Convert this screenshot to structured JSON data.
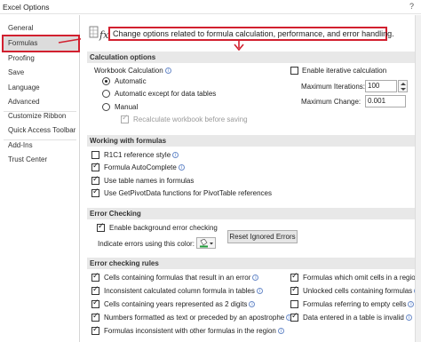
{
  "window": {
    "title": "Excel Options",
    "help": "?"
  },
  "sidebar": {
    "items": [
      {
        "label": "General"
      },
      {
        "label": "Formulas"
      },
      {
        "label": "Proofing"
      },
      {
        "label": "Save"
      },
      {
        "label": "Language"
      },
      {
        "label": "Advanced"
      },
      {
        "label": "Customize Ribbon"
      },
      {
        "label": "Quick Access Toolbar"
      },
      {
        "label": "Add-Ins"
      },
      {
        "label": "Trust Center"
      }
    ],
    "selected": "Formulas"
  },
  "header": {
    "text": "Change options related to formula calculation, performance, and error handling."
  },
  "calculation": {
    "section_title": "Calculation options",
    "workbook_label": "Workbook Calculation",
    "radio_automatic": "Automatic",
    "radio_except": "Automatic except for data tables",
    "radio_manual": "Manual",
    "selected": "Automatic",
    "recalc_label": "Recalculate workbook before saving",
    "iterative_label": "Enable iterative calculation",
    "max_iter_label": "Maximum Iterations:",
    "max_iter_value": "100",
    "max_change_label": "Maximum Change:",
    "max_change_value": "0.001"
  },
  "working": {
    "section_title": "Working with formulas",
    "r1c1": "R1C1 reference style",
    "autocomplete": "Formula AutoComplete",
    "table_names": "Use table names in formulas",
    "getpivot": "Use GetPivotData functions for PivotTable references"
  },
  "error_checking": {
    "section_title": "Error Checking",
    "enable_bg": "Enable background error checking",
    "indicate_color": "Indicate errors using this color:",
    "reset_button": "Reset Ignored Errors"
  },
  "rules": {
    "section_title": "Error checking rules",
    "left": [
      "Cells containing formulas that result in an error",
      "Inconsistent calculated column formula in tables",
      "Cells containing years represented as 2 digits",
      "Numbers formatted as text or preceded by an apostrophe",
      "Formulas inconsistent with other formulas in the region"
    ],
    "right": [
      "Formulas which omit cells in a region",
      "Unlocked cells containing formulas",
      "Formulas referring to empty cells",
      "Data entered in a table is invalid"
    ]
  },
  "colors": {
    "accent_red": "#d2202f",
    "selected_bg": "#dcdcdc",
    "section_bg": "#e8e8e8"
  }
}
